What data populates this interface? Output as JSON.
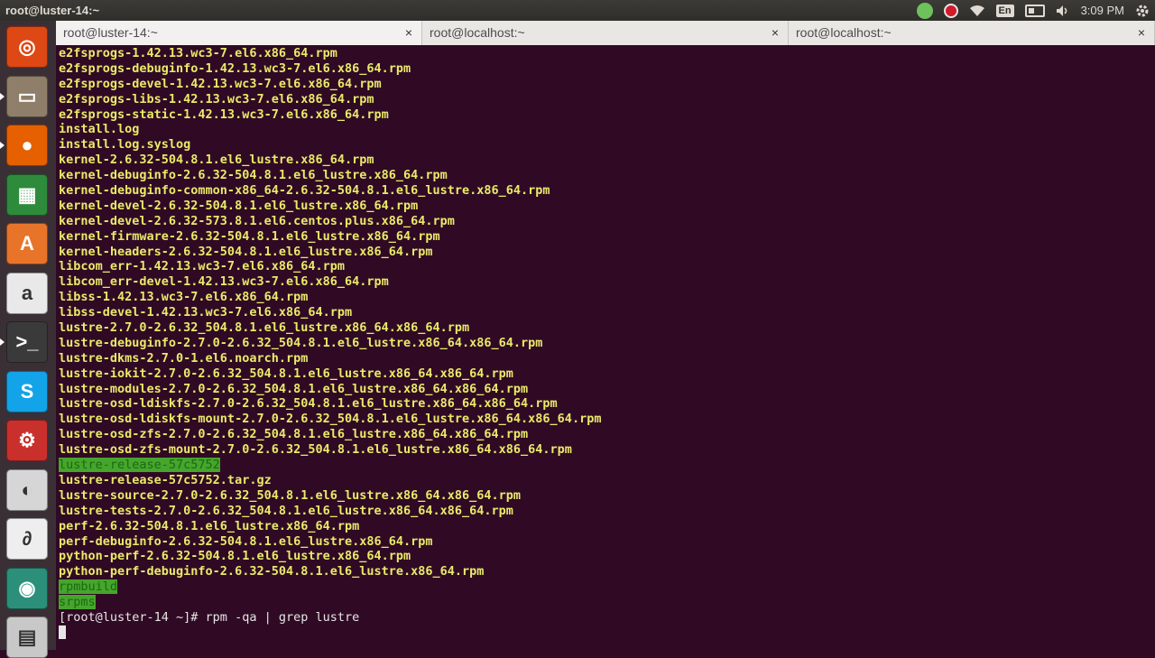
{
  "panel": {
    "window_title": "root@luster-14:~",
    "keyboard_layout": "En",
    "clock": "3:09 PM"
  },
  "launcher": [
    {
      "name": "ubuntu-dash-icon",
      "color": "#dd4814",
      "glyph": "◎"
    },
    {
      "name": "files-icon",
      "color": "#8f7f6a",
      "glyph": "▭"
    },
    {
      "name": "firefox-icon",
      "color": "#e66000",
      "glyph": "●"
    },
    {
      "name": "libreoffice-calc-icon",
      "color": "#2e8b3c",
      "glyph": "▦"
    },
    {
      "name": "software-center-icon",
      "color": "#e8742a",
      "glyph": "A"
    },
    {
      "name": "amazon-icon",
      "color": "#e9e9e9",
      "glyph": "a"
    },
    {
      "name": "terminal-icon",
      "color": "#3a3a3a",
      "glyph": ">_"
    },
    {
      "name": "skype-icon",
      "color": "#13a3e8",
      "glyph": "S"
    },
    {
      "name": "system-settings-icon",
      "color": "#c9302c",
      "glyph": "⚙"
    },
    {
      "name": "media-player-icon",
      "color": "#d6d6d6",
      "glyph": "◐"
    },
    {
      "name": "pdf-viewer-icon",
      "color": "#eeeeee",
      "glyph": "∂"
    },
    {
      "name": "camera-icon",
      "color": "#2b8f7a",
      "glyph": "◉"
    },
    {
      "name": "trash-icon",
      "color": "#c8c8c8",
      "glyph": "▤"
    }
  ],
  "tabs": [
    {
      "label": "root@luster-14:~",
      "active": true
    },
    {
      "label": "root@localhost:~",
      "active": false
    },
    {
      "label": "root@localhost:~",
      "active": false
    }
  ],
  "tab_close_glyph": "×",
  "terminal": {
    "lines": [
      "e2fsprogs-1.42.13.wc3-7.el6.x86_64.rpm",
      "e2fsprogs-debuginfo-1.42.13.wc3-7.el6.x86_64.rpm",
      "e2fsprogs-devel-1.42.13.wc3-7.el6.x86_64.rpm",
      "e2fsprogs-libs-1.42.13.wc3-7.el6.x86_64.rpm",
      "e2fsprogs-static-1.42.13.wc3-7.el6.x86_64.rpm",
      "install.log",
      "install.log.syslog",
      "kernel-2.6.32-504.8.1.el6_lustre.x86_64.rpm",
      "kernel-debuginfo-2.6.32-504.8.1.el6_lustre.x86_64.rpm",
      "kernel-debuginfo-common-x86_64-2.6.32-504.8.1.el6_lustre.x86_64.rpm",
      "kernel-devel-2.6.32-504.8.1.el6_lustre.x86_64.rpm",
      "kernel-devel-2.6.32-573.8.1.el6.centos.plus.x86_64.rpm",
      "kernel-firmware-2.6.32-504.8.1.el6_lustre.x86_64.rpm",
      "kernel-headers-2.6.32-504.8.1.el6_lustre.x86_64.rpm",
      "libcom_err-1.42.13.wc3-7.el6.x86_64.rpm",
      "libcom_err-devel-1.42.13.wc3-7.el6.x86_64.rpm",
      "libss-1.42.13.wc3-7.el6.x86_64.rpm",
      "libss-devel-1.42.13.wc3-7.el6.x86_64.rpm",
      "lustre-2.7.0-2.6.32_504.8.1.el6_lustre.x86_64.x86_64.rpm",
      "lustre-debuginfo-2.7.0-2.6.32_504.8.1.el6_lustre.x86_64.x86_64.rpm",
      "lustre-dkms-2.7.0-1.el6.noarch.rpm",
      "lustre-iokit-2.7.0-2.6.32_504.8.1.el6_lustre.x86_64.x86_64.rpm",
      "lustre-modules-2.7.0-2.6.32_504.8.1.el6_lustre.x86_64.x86_64.rpm",
      "lustre-osd-ldiskfs-2.7.0-2.6.32_504.8.1.el6_lustre.x86_64.x86_64.rpm",
      "lustre-osd-ldiskfs-mount-2.7.0-2.6.32_504.8.1.el6_lustre.x86_64.x86_64.rpm",
      "lustre-osd-zfs-2.7.0-2.6.32_504.8.1.el6_lustre.x86_64.x86_64.rpm",
      "lustre-osd-zfs-mount-2.7.0-2.6.32_504.8.1.el6_lustre.x86_64.x86_64.rpm",
      "lustre-release-57c5752",
      "lustre-release-57c5752.tar.gz",
      "lustre-source-2.7.0-2.6.32_504.8.1.el6_lustre.x86_64.x86_64.rpm",
      "lustre-tests-2.7.0-2.6.32_504.8.1.el6_lustre.x86_64.x86_64.rpm",
      "perf-2.6.32-504.8.1.el6_lustre.x86_64.rpm",
      "perf-debuginfo-2.6.32-504.8.1.el6_lustre.x86_64.rpm",
      "python-perf-2.6.32-504.8.1.el6_lustre.x86_64.rpm",
      "python-perf-debuginfo-2.6.32-504.8.1.el6_lustre.x86_64.rpm",
      "rpmbuild",
      "srpms"
    ],
    "highlighted_lines": [
      27,
      35,
      36
    ],
    "prompt": "[root@luster-14 ~]# rpm -qa | grep lustre"
  }
}
